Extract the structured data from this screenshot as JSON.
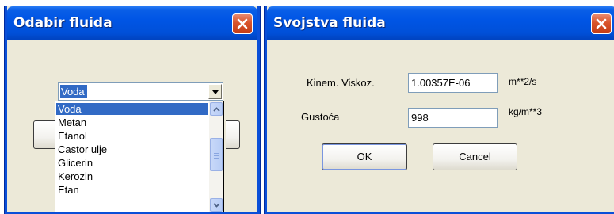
{
  "fluid_picker": {
    "title": "Odabir fluida",
    "selected_value": "Voda",
    "options": [
      "Voda",
      "Metan",
      "Etanol",
      "Castor ulje",
      "Glicerin",
      "Kerozin",
      "Etan"
    ],
    "selected_index": 0
  },
  "fluid_properties": {
    "title": "Svojstva fluida",
    "viscosity_label": "Kinem. Viskoz.",
    "viscosity_value": "1.00357E-06",
    "viscosity_unit": "m**2/s",
    "density_label": "Gustoća",
    "density_value": "998",
    "density_unit": "kg/m**3",
    "ok_label": "OK",
    "cancel_label": "Cancel"
  }
}
